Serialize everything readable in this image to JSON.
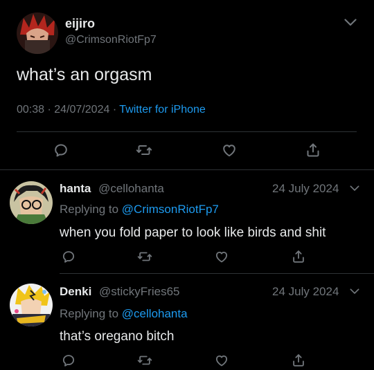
{
  "main_tweet": {
    "display_name": "eijiro",
    "handle": "@CrimsonRiotFp7",
    "text": "what’s an orgasm",
    "time": "00:38",
    "date": "24/07/2024",
    "client": "Twitter for iPhone",
    "separator": "·"
  },
  "replies": [
    {
      "display_name": "hanta",
      "handle": "@cellohanta",
      "date": "24 July 2024",
      "replying_prefix": "Replying to",
      "replying_to": "@CrimsonRiotFp7",
      "text": "when you fold paper to look like birds and shit"
    },
    {
      "display_name": "Denki",
      "handle": "@stickyFries65",
      "date": "24 July 2024",
      "replying_prefix": "Replying to",
      "replying_to": "@cellohanta",
      "text": "that’s oregano bitch"
    }
  ],
  "icons": [
    "chevron-down-icon",
    "reply-icon",
    "retweet-icon",
    "like-icon",
    "share-icon"
  ],
  "colors": {
    "background": "#000000",
    "text": "#e7e9ea",
    "secondary": "#71767b",
    "link": "#1d9bf0",
    "divider": "#2f3336"
  }
}
